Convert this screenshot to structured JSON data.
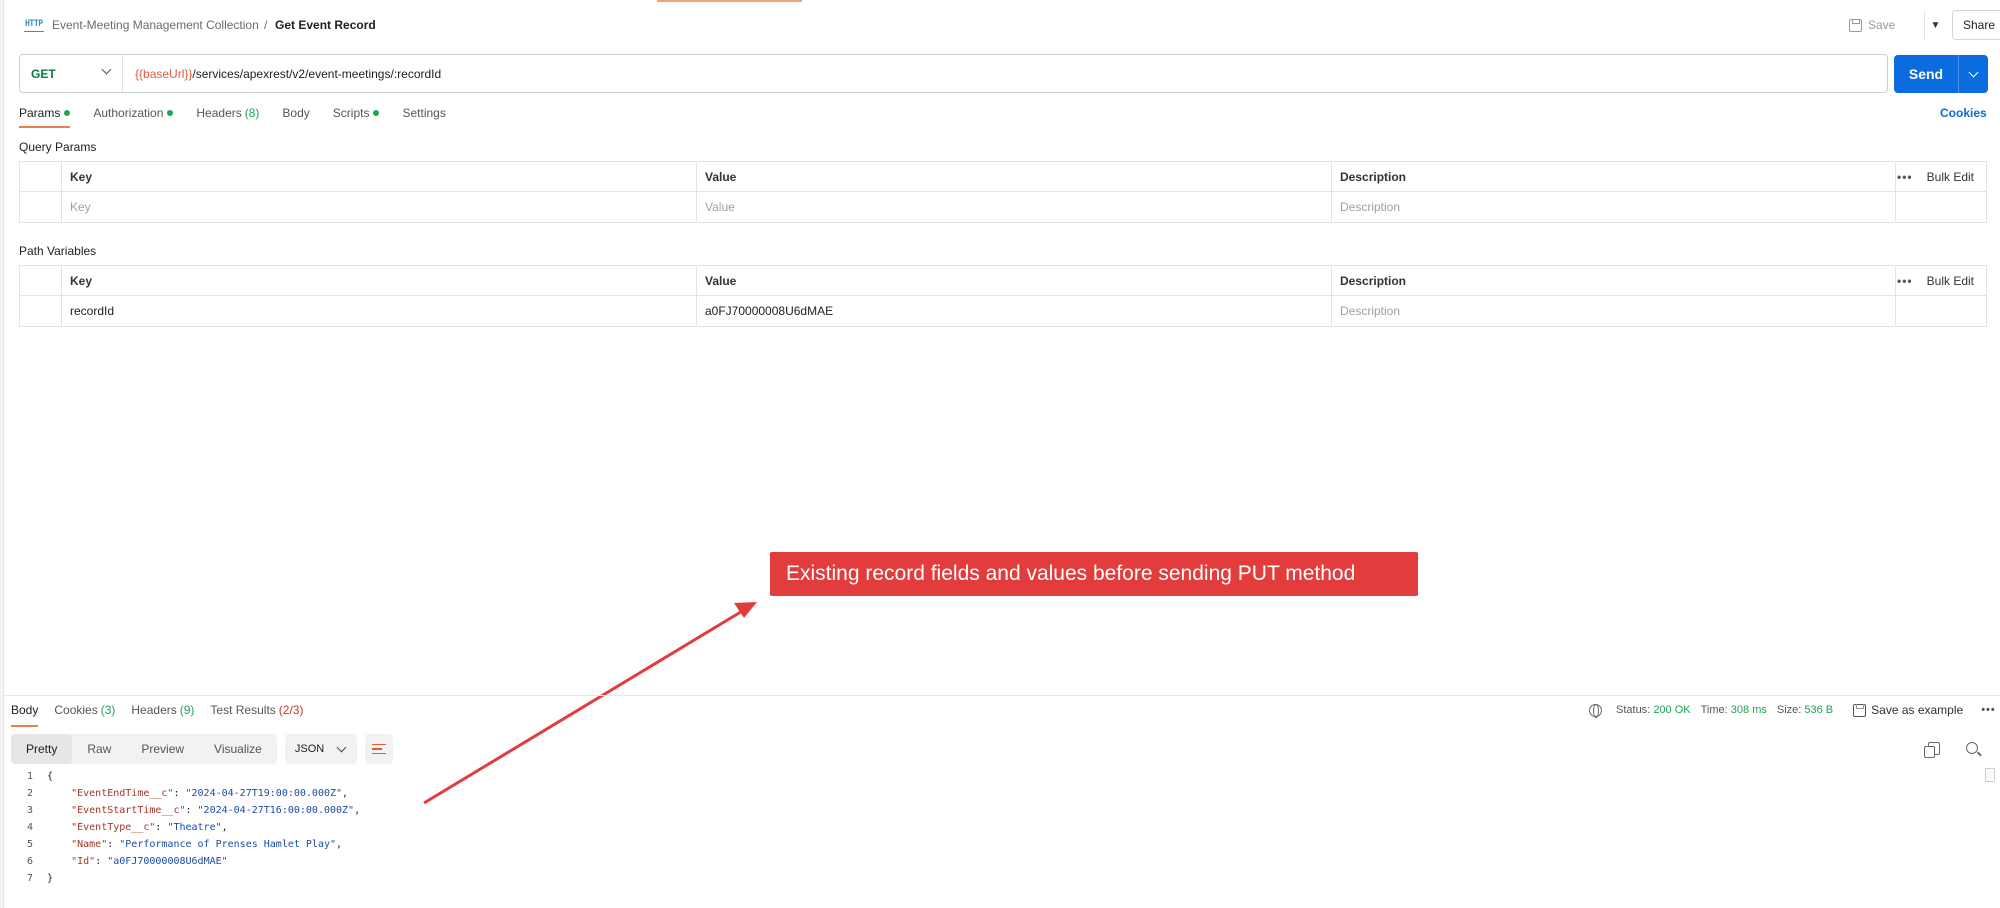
{
  "header": {
    "icon_text": "HTTP",
    "collection": "Event-Meeting Management Collection",
    "separator": "/",
    "request_name": "Get Event Record",
    "save_label": "Save",
    "share_label": "Share"
  },
  "url_bar": {
    "method": "GET",
    "url_var": "{{baseUrl}}",
    "url_path": "/services/apexrest/v2/event-meetings/:recordId",
    "send_label": "Send"
  },
  "request_tabs": [
    {
      "label": "Params",
      "dot": true,
      "count": ""
    },
    {
      "label": "Authorization",
      "dot": true,
      "count": ""
    },
    {
      "label": "Headers",
      "dot": false,
      "count": "(8)"
    },
    {
      "label": "Body",
      "dot": false,
      "count": ""
    },
    {
      "label": "Scripts",
      "dot": true,
      "count": ""
    },
    {
      "label": "Settings",
      "dot": false,
      "count": ""
    }
  ],
  "cookies_link": "Cookies",
  "query_params": {
    "title": "Query Params",
    "headers": {
      "key": "Key",
      "value": "Value",
      "description": "Description",
      "bulk_edit": "Bulk Edit",
      "more": "•••"
    },
    "placeholder_row": {
      "key": "Key",
      "value": "Value",
      "description": "Description"
    }
  },
  "path_variables": {
    "title": "Path Variables",
    "headers": {
      "key": "Key",
      "value": "Value",
      "description": "Description",
      "bulk_edit": "Bulk Edit",
      "more": "•••"
    },
    "rows": [
      {
        "key": "recordId",
        "value": "a0FJ70000008U6dMAE",
        "description": "Description"
      }
    ]
  },
  "annotation": {
    "text": "Existing record fields and values before sending PUT method",
    "color": "#e33c3c"
  },
  "response_tabs": [
    {
      "label": "Body",
      "count": ""
    },
    {
      "label": "Cookies",
      "count": "(3)"
    },
    {
      "label": "Headers",
      "count": "(9)"
    },
    {
      "label": "Test Results",
      "count": "(2/3)"
    }
  ],
  "status": {
    "status_label": "Status:",
    "status_value": "200 OK",
    "time_label": "Time:",
    "time_value": "308 ms",
    "size_label": "Size:",
    "size_value": "536 B",
    "save_example": "Save as example",
    "more": "•••"
  },
  "format_tabs": [
    "Pretty",
    "Raw",
    "Preview",
    "Visualize"
  ],
  "format_select": "JSON",
  "code_lines": [
    {
      "n": "1",
      "key": "",
      "value": "",
      "raw": "{"
    },
    {
      "n": "2",
      "key": "\"EventEndTime__c\"",
      "value": "\"2024-04-27T19:00:00.000Z\"",
      "raw": ""
    },
    {
      "n": "3",
      "key": "\"EventStartTime__c\"",
      "value": "\"2024-04-27T16:00:00.000Z\"",
      "raw": ""
    },
    {
      "n": "4",
      "key": "\"EventType__c\"",
      "value": "\"Theatre\"",
      "raw": ""
    },
    {
      "n": "5",
      "key": "\"Name\"",
      "value": "\"Performance of Prenses Hamlet Play\"",
      "raw": ""
    },
    {
      "n": "6",
      "key": "\"Id\"",
      "value": "\"a0FJ70000008U6dMAE\"",
      "raw": ""
    },
    {
      "n": "7",
      "key": "",
      "value": "",
      "raw": "}"
    }
  ],
  "colors": {
    "accent": "#ef7c4b",
    "send": "#0b6ce0",
    "method_get": "#0c7a3c",
    "success": "#1ea552"
  }
}
